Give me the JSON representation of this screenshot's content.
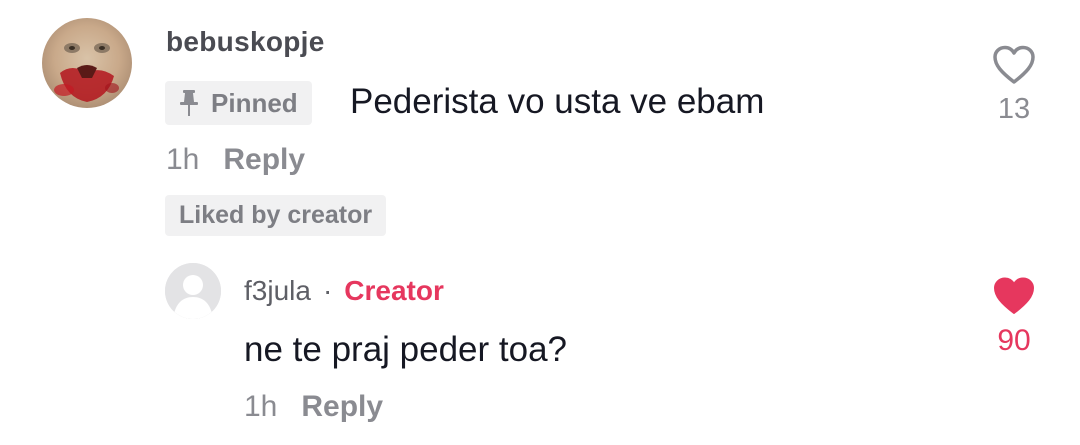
{
  "comment": {
    "username": "bebuskopje",
    "pinned_label": "Pinned",
    "text": "Pederista vo usta ve ebam",
    "time": "1h",
    "reply_label": "Reply",
    "liked_by_creator": "Liked by creator",
    "like_count": "13",
    "liked": false
  },
  "reply": {
    "username": "f3jula",
    "separator": "·",
    "badge": "Creator",
    "text": "ne te praj peder toa?",
    "time": "1h",
    "reply_label": "Reply",
    "like_count": "90",
    "liked": true
  },
  "colors": {
    "accent_red": "#e6375e",
    "muted_gray": "#8a8b91",
    "badge_bg": "#f1f1f2"
  },
  "icons": {
    "pin": "pin-icon",
    "heart_outline": "heart-outline-icon",
    "heart_filled": "heart-filled-icon",
    "default_avatar": "default-avatar-icon"
  }
}
